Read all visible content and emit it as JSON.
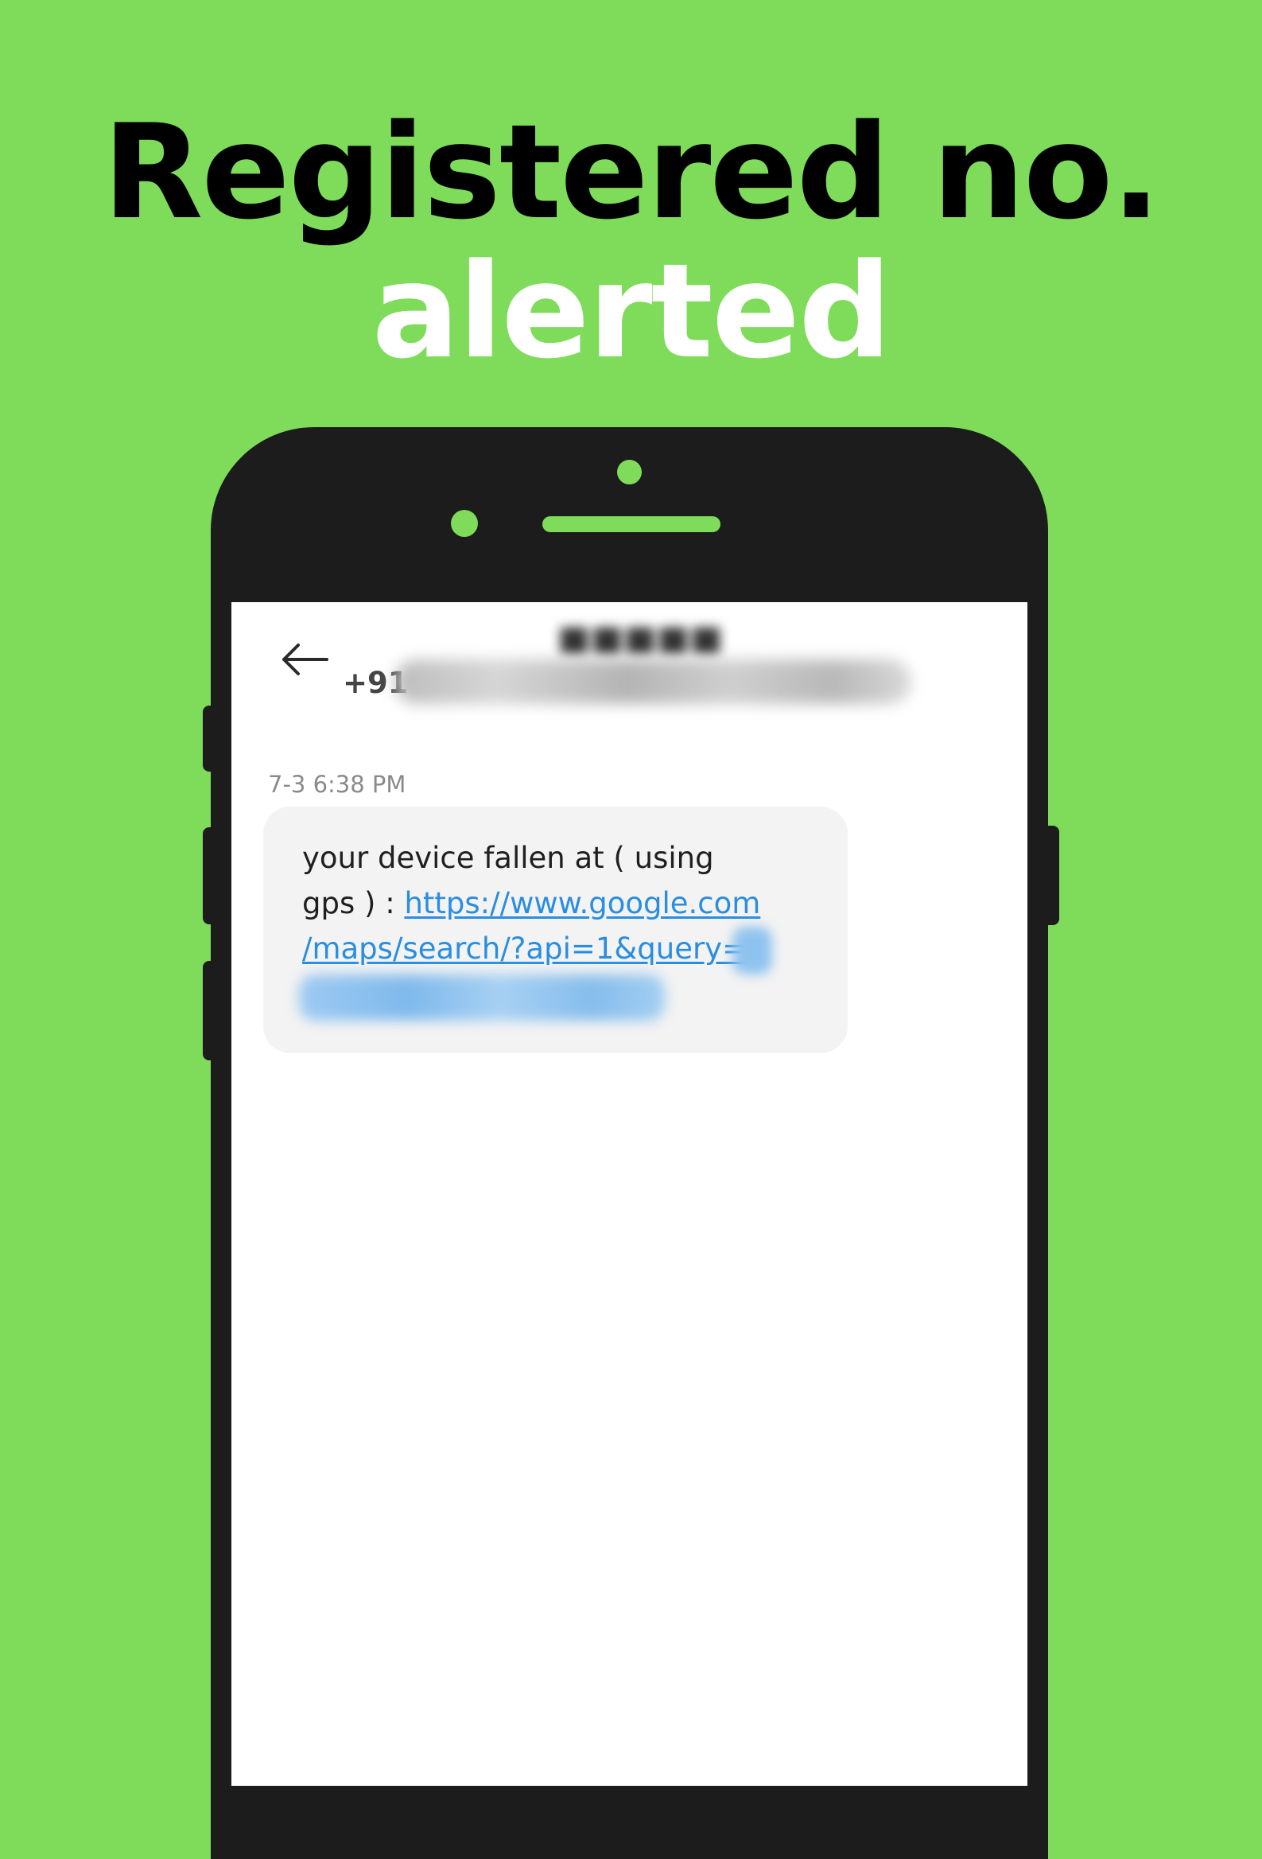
{
  "headline": {
    "line1": "Registered no.",
    "line2": "alerted"
  },
  "colors": {
    "background": "#7fdb5a",
    "phone_body": "#1c1c1c",
    "link": "#2a8ee0",
    "bubble": "#f3f3f3"
  },
  "header": {
    "back_icon": "back-arrow-icon",
    "contact_number_prefix": "+91"
  },
  "message": {
    "timestamp": "7-3 6:38 PM",
    "text_line1": "your device fallen at ( using",
    "text_line2_prefix": "gps ) : ",
    "link_line1": "https://www.google.com",
    "link_line2": "/maps/search/?api=1&query="
  }
}
